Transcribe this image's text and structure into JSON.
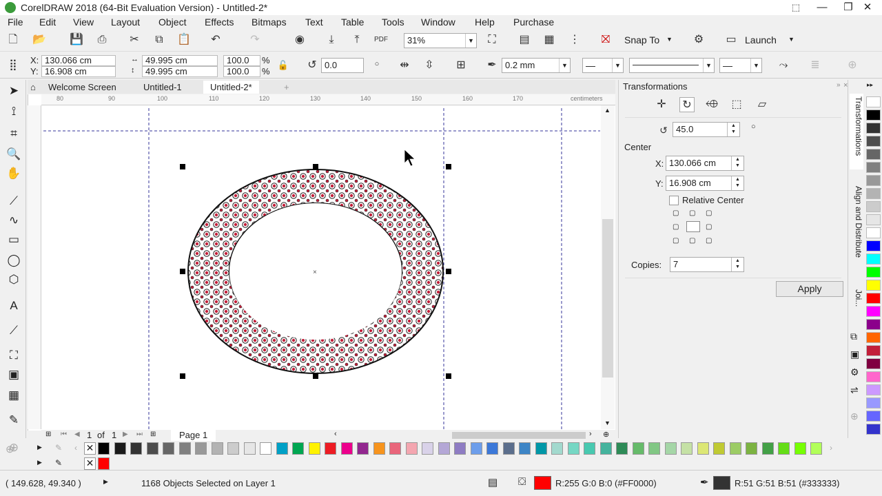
{
  "app": {
    "title": "CorelDRAW 2018 (64-Bit Evaluation Version) - Untitled-2*"
  },
  "menu": [
    "File",
    "Edit",
    "View",
    "Layout",
    "Object",
    "Effects",
    "Bitmaps",
    "Text",
    "Table",
    "Tools",
    "Window",
    "Help",
    "Purchase"
  ],
  "toolbar": {
    "zoom_value": "31%",
    "snap_to_label": "Snap To",
    "launch_label": "Launch"
  },
  "property_bar": {
    "x": "130.066 cm",
    "y": "16.908 cm",
    "width": "49.995 cm",
    "height": "49.995 cm",
    "scale_w": "100.0",
    "scale_h": "100.0",
    "pct1": "%",
    "pct2": "%",
    "rotation": "0.0",
    "outline_width": "0.2 mm",
    "x_label": "X:",
    "y_label": "Y:"
  },
  "tabs": [
    "Welcome Screen",
    "Untitled-1",
    "Untitled-2*"
  ],
  "ruler": {
    "ticks": [
      "80",
      "90",
      "100",
      "110",
      "120",
      "130",
      "140",
      "150",
      "160",
      "170"
    ],
    "unit": "centimeters"
  },
  "page_nav": {
    "current": "1",
    "of_label": "of",
    "total": "1",
    "page_tab": "Page 1"
  },
  "docker": {
    "title": "Transformations",
    "angle": "45.0",
    "center_label": "Center",
    "x_label": "X:",
    "x_value": "130.066 cm",
    "y_label": "Y:",
    "y_value": "16.908 cm",
    "relative_center_label": "Relative Center",
    "copies_label": "Copies:",
    "copies_value": "7",
    "apply_label": "Apply"
  },
  "docker_tabs": [
    "Transformations",
    "Align and Distribute",
    "Joi..."
  ],
  "palette": {
    "colors": [
      "#000000",
      "#1a1a1a",
      "#333333",
      "#4d4d4d",
      "#666666",
      "#808080",
      "#999999",
      "#b3b3b3",
      "#cccccc",
      "#e6e6e6",
      "#ffffff",
      "#00a0c6",
      "#00a651",
      "#fff200",
      "#ed1c24",
      "#ec008c",
      "#92278f",
      "#f7941d",
      "#e9657b",
      "#f4a6b0",
      "#d9d2e9",
      "#b4a7d6",
      "#8e7cc3",
      "#6d9eeb",
      "#3c78d8",
      "#5b6e8c",
      "#3d85c6",
      "#0097a7",
      "#a2d9ce",
      "#76d7c4",
      "#48c9b0",
      "#45b39d",
      "#2e8b57",
      "#66bb6a",
      "#81c784",
      "#a5d6a7",
      "#c5e1a5",
      "#dce775",
      "#c0ca33",
      "#9ccc65",
      "#7cb342",
      "#43a047",
      "#64dd17",
      "#76ff03",
      "#b2ff59"
    ],
    "right_colors": [
      "#ffffff",
      "#000000",
      "#333333",
      "#4d4d4d",
      "#666666",
      "#808080",
      "#999999",
      "#b3b3b3",
      "#cccccc",
      "#e6e6e6",
      "#ffffff",
      "#0000ff",
      "#00ffff",
      "#00ff00",
      "#ffff00",
      "#ff0000",
      "#ff00ff",
      "#8b008b",
      "#ff6600",
      "#c21f3a",
      "#800040",
      "#ff66cc",
      "#cc99ff",
      "#9999ff",
      "#6666ff",
      "#3333cc"
    ]
  },
  "status": {
    "coords": "( 149.628, 49.340 )",
    "selection": "1168 Objects Selected on Layer 1",
    "fill_text": "R:255 G:0 B:0 (#FF0000)",
    "outline_text": "R:51 G:51 B:51 (#333333)",
    "fill_color": "#ff0000",
    "outline_color": "#333333"
  },
  "colors": {
    "accent": "#2a6ebb",
    "ring_red": "#c21f3a"
  }
}
